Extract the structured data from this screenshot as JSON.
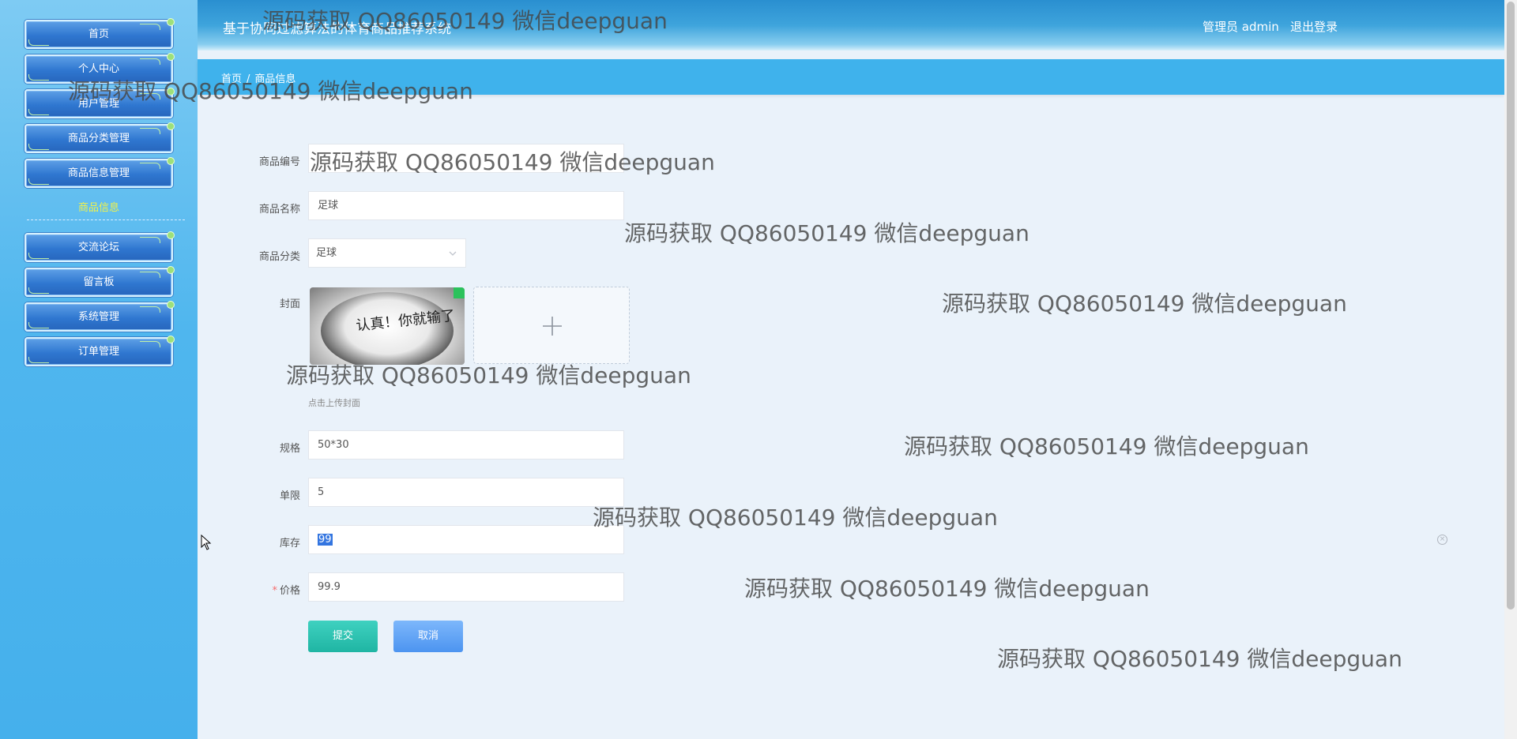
{
  "sidebar": {
    "items": [
      {
        "label": "首页"
      },
      {
        "label": "个人中心"
      },
      {
        "label": "用户管理"
      },
      {
        "label": "商品分类管理"
      },
      {
        "label": "商品信息管理"
      },
      {
        "label": "交流论坛"
      },
      {
        "label": "留言板"
      },
      {
        "label": "系统管理"
      },
      {
        "label": "订单管理"
      }
    ],
    "submenu_label": "商品信息"
  },
  "header": {
    "title": "基于协同过滤算法的体育商品推荐系统",
    "user": "管理员 admin",
    "logout": "退出登录"
  },
  "breadcrumb": {
    "home": "首页",
    "separator": "/",
    "current": "商品信息"
  },
  "form": {
    "product_no": {
      "label": "商品编号",
      "value": ""
    },
    "product_name": {
      "label": "商品名称",
      "value": "足球"
    },
    "category": {
      "label": "商品分类",
      "value": "足球"
    },
    "cover": {
      "label": "封面",
      "tip": "点击上传封面",
      "image_text": "认真！你就输了"
    },
    "spec": {
      "label": "规格",
      "value": "50*30"
    },
    "limit": {
      "label": "单限",
      "value": "5"
    },
    "stock": {
      "label": "库存",
      "value": "99"
    },
    "price": {
      "label": "价格",
      "required_mark": "*",
      "value": "99.9"
    },
    "submit": "提交",
    "cancel": "取消"
  },
  "watermark": "源码获取 QQ86050149 微信deepguan",
  "icons": {
    "upload": "plus-icon",
    "select_arrow": "chevron-down-icon",
    "close": "close-circle-icon",
    "pointer": "mouse-cursor-icon"
  },
  "colors": {
    "sidebar": "#4fb6ee",
    "header": "#2a8fd0",
    "breadcrumb_bar": "#3fb2ec",
    "submit_button": "#1fb5a3",
    "cancel_button": "#4c94f0",
    "submenu_active": "#f2f24a",
    "required": "#f56c6c"
  }
}
